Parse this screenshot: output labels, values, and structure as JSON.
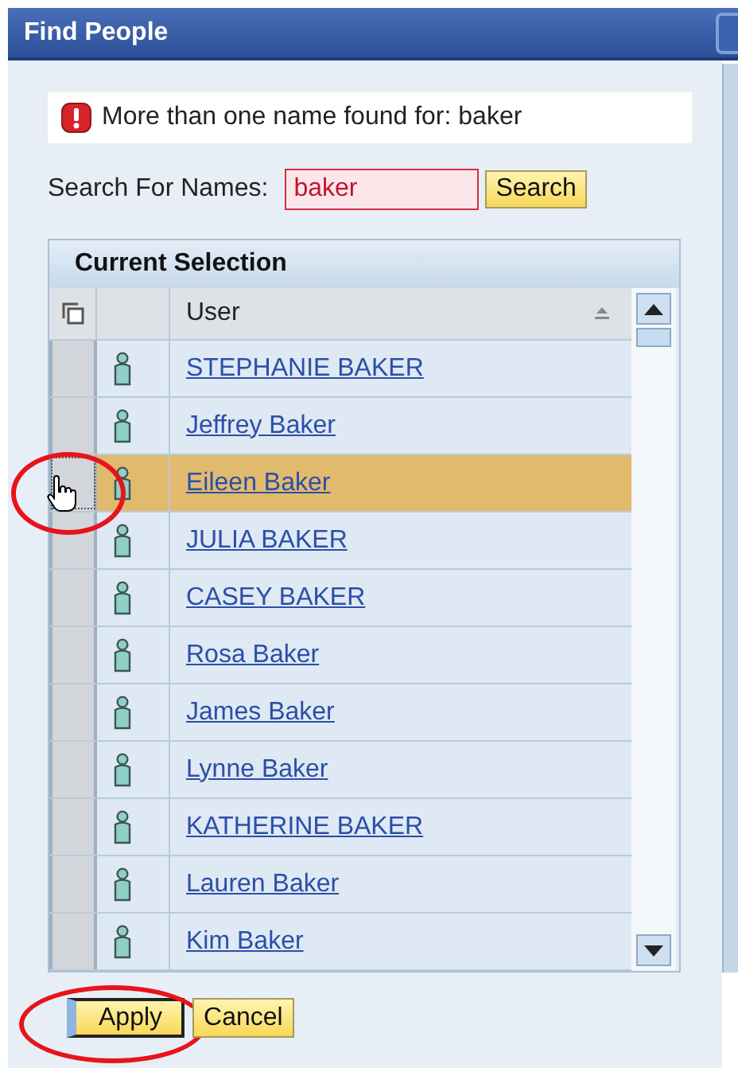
{
  "window": {
    "title": "Find People"
  },
  "message": {
    "text": "More than one name found for: baker"
  },
  "search": {
    "label": "Search For Names:",
    "value": "baker",
    "button": "Search"
  },
  "table": {
    "title": "Current Selection",
    "columns": [
      "User"
    ],
    "rows": [
      {
        "user": "STEPHANIE BAKER",
        "selected": false
      },
      {
        "user": "Jeffrey Baker",
        "selected": false
      },
      {
        "user": "Eileen Baker",
        "selected": true,
        "circled": true
      },
      {
        "user": "JULIA BAKER",
        "selected": false
      },
      {
        "user": "CASEY BAKER",
        "selected": false
      },
      {
        "user": "Rosa Baker",
        "selected": false
      },
      {
        "user": "James Baker",
        "selected": false
      },
      {
        "user": "Lynne Baker",
        "selected": false
      },
      {
        "user": "KATHERINE BAKER",
        "selected": false
      },
      {
        "user": "Lauren Baker",
        "selected": false
      },
      {
        "user": "Kim Baker",
        "selected": false
      }
    ]
  },
  "buttons": [
    {
      "label": "Apply",
      "focused": true,
      "circled": true
    },
    {
      "label": "Cancel",
      "focused": false
    }
  ]
}
